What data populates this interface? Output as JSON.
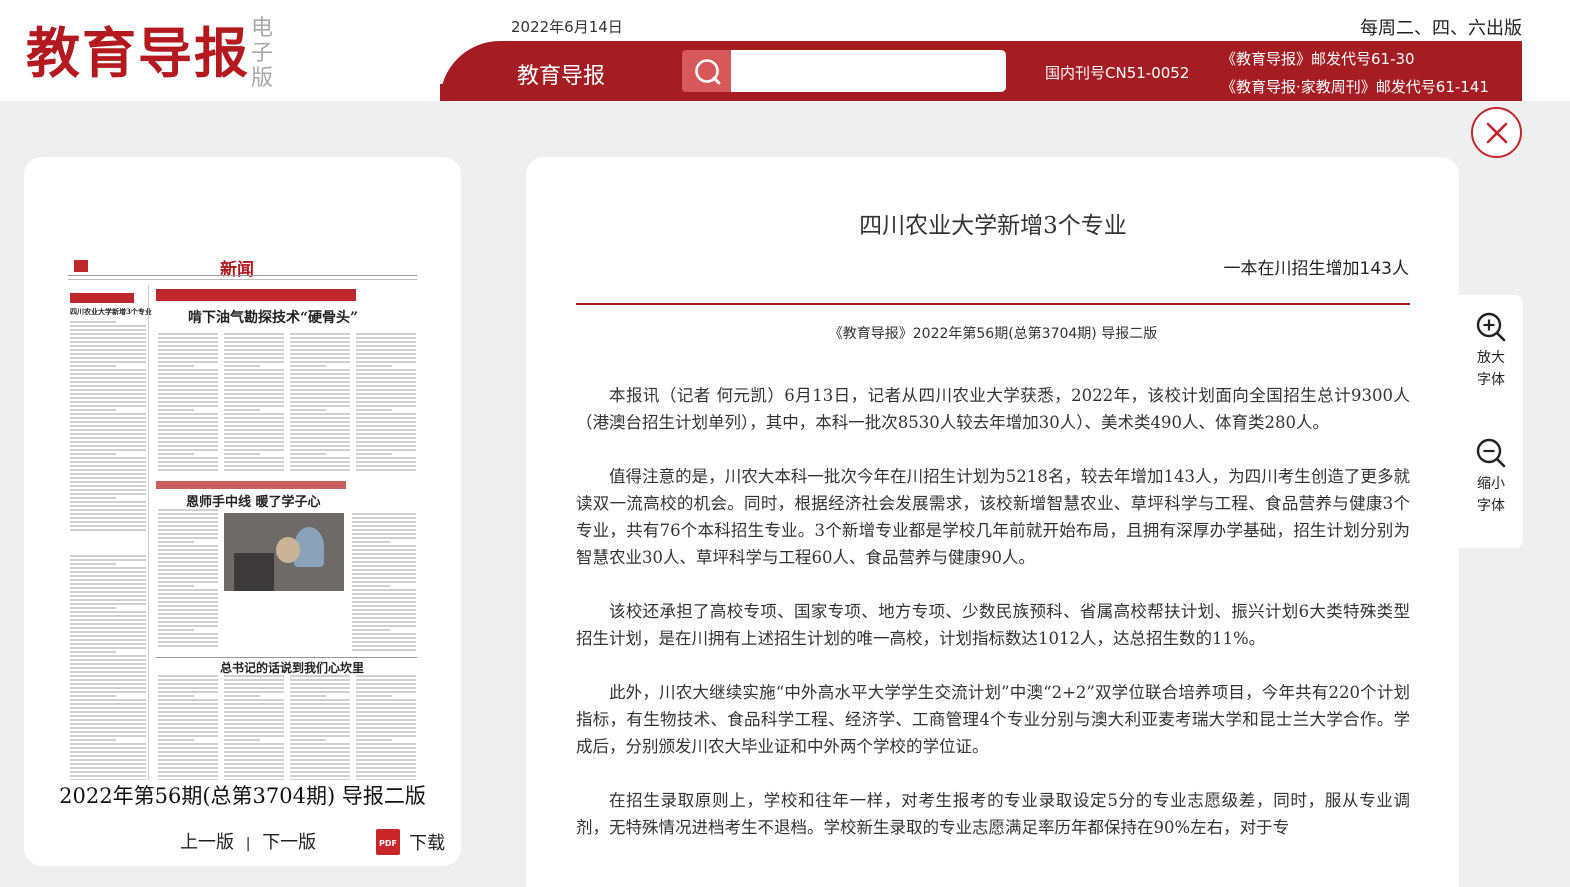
{
  "header": {
    "logo": "教育导报",
    "logo_sub": "电子版",
    "date": "2022年6月14日",
    "schedule": "每周二、四、六出版",
    "brand": "教育导报",
    "search_placeholder": "",
    "cn_code": "国内刊号CN51-0052",
    "postal_1": "《教育导报》邮发代号61-30",
    "postal_2": "《教育导报·家教周刊》邮发代号61-141"
  },
  "thumbnail": {
    "page_header": "新闻",
    "headline_1": "啃下油气勘探技术“硬骨头”",
    "headline_2": "恩师手中线 暖了学子心",
    "headline_3": "总书记的话说到我们心坎里",
    "side_headline": "四川农业大学新增3个专业",
    "caption": "2022年第56期(总第3704期) 导报二版",
    "prev": "上一版",
    "separator": "|",
    "next": "下一版",
    "download": "下载",
    "pdf_icon": "PDF"
  },
  "article": {
    "title": "四川农业大学新增3个专业",
    "subtitle": "一本在川招生增加143人",
    "source": "《教育导报》2022年第56期(总第3704期) 导报二版",
    "paragraphs": [
      "本报讯（记者 何元凯）6月13日，记者从四川农业大学获悉，2022年，该校计划面向全国招生总计9300人（港澳台招生计划单列），其中，本科一批次8530人较去年增加30人）、美术类490人、体育类280人。",
      "值得注意的是，川农大本科一批次今年在川招生计划为5218名，较去年增加143人，为四川考生创造了更多就读双一流高校的机会。同时，根据经济社会发展需求，该校新增智慧农业、草坪科学与工程、食品营养与健康3个专业，共有76个本科招生专业。3个新增专业都是学校几年前就开始布局，且拥有深厚办学基础，招生计划分别为智慧农业30人、草坪科学与工程60人、食品营养与健康90人。",
      "该校还承担了高校专项、国家专项、地方专项、少数民族预科、省属高校帮扶计划、振兴计划6大类特殊类型招生计划，是在川拥有上述招生计划的唯一高校，计划指标数达1012人，达总招生数的11%。",
      "此外，川农大继续实施“中外高水平大学学生交流计划”中澳“2+2”双学位联合培养项目，今年共有220个计划指标，有生物技术、食品科学工程、经济学、工商管理4个专业分别与澳大利亚麦考瑞大学和昆士兰大学合作。学成后，分别颁发川农大毕业证和中外两个学校的学位证。",
      "在招生录取原则上，学校和往年一样，对考生报考的专业录取设定5分的专业志愿级差，同时，服从专业调剂，无特殊情况进档考生不退档。学校新生录取的专业志愿满足率历年都保持在90%左右，对于专"
    ]
  },
  "tools": {
    "zoom_in": "放大字体",
    "zoom_out": "缩小字体"
  },
  "colors": {
    "brand_red": "#a51d22",
    "logo_red": "#b3191e",
    "search_button": "#d6585a"
  },
  "icons": [
    "search-icon",
    "close-icon",
    "zoom-in-icon",
    "zoom-out-icon",
    "pdf-icon"
  ]
}
